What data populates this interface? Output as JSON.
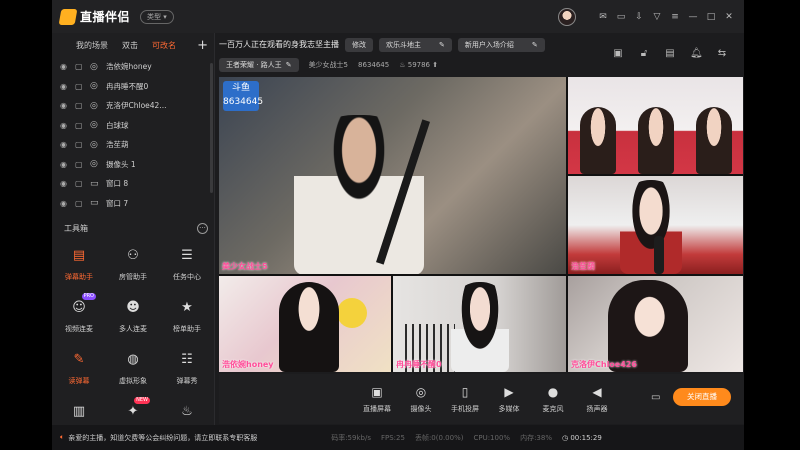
{
  "app": {
    "name": "直播伴侣",
    "type_label": "类型"
  },
  "scene_tabs": [
    "我的场景",
    "双击",
    "可改名"
  ],
  "sources": [
    {
      "name": "浩依婉honey",
      "kind": "camera-icon"
    },
    {
      "name": "冉冉睡不醒0",
      "kind": "camera-icon"
    },
    {
      "name": "克洛伊Chloe42...",
      "kind": "camera-icon"
    },
    {
      "name": "白球球",
      "kind": "camera-icon"
    },
    {
      "name": "浩苼葫",
      "kind": "camera-icon"
    },
    {
      "name": "摄像头 1",
      "kind": "camera-icon"
    },
    {
      "name": "窗口 8",
      "kind": "window-icon"
    },
    {
      "name": "窗口 7",
      "kind": "window-icon"
    }
  ],
  "toolbox": {
    "title": "工具箱",
    "items": [
      {
        "label": "弹幕助手",
        "icon": "danmaku-icon",
        "active": true
      },
      {
        "label": "房管助手",
        "icon": "user-manage-icon"
      },
      {
        "label": "任务中心",
        "icon": "task-icon"
      },
      {
        "label": "视频连麦",
        "icon": "video-call-icon",
        "badge": "PRO"
      },
      {
        "label": "多人连麦",
        "icon": "multi-call-icon"
      },
      {
        "label": "榜单助手",
        "icon": "rank-icon"
      },
      {
        "label": "读弹幕",
        "icon": "read-danmaku-icon",
        "active": true
      },
      {
        "label": "虚拟形象",
        "icon": "avatar-icon"
      },
      {
        "label": "弹幕秀",
        "icon": "danmaku-show-icon"
      },
      {
        "label": "",
        "icon": "book-icon"
      },
      {
        "label": "",
        "icon": "game-icon",
        "badge": "NEW"
      },
      {
        "label": "",
        "icon": "fire-icon"
      }
    ]
  },
  "stream": {
    "title": "一百万人正在观看的身我志坚主播",
    "edit_label": "修改",
    "category": "欢乐斗地主",
    "greeting": "新用户入场介绍",
    "game_tag": "王者荣耀 · 路人王",
    "streamer": "美少女战士5",
    "room_id": "8634645",
    "hot": "59786"
  },
  "tiles": [
    {
      "label": "美少女战士5"
    },
    {
      "label": ""
    },
    {
      "label": "浩苼葫"
    },
    {
      "label": "浩依婉honey"
    },
    {
      "label": "冉冉睡不醒0"
    },
    {
      "label": "克洛伊Chloe426"
    }
  ],
  "bottom_tools": [
    {
      "label": "直播屏幕",
      "icon": "screen-icon"
    },
    {
      "label": "摄像头",
      "icon": "camera-icon"
    },
    {
      "label": "手机投屏",
      "icon": "phone-cast-icon"
    },
    {
      "label": "多媒体",
      "icon": "media-icon"
    },
    {
      "label": "麦克风",
      "icon": "mic-icon"
    },
    {
      "label": "扬声器",
      "icon": "speaker-icon"
    }
  ],
  "close_live_label": "关闭直播",
  "status": {
    "notice": "亲爱的主播，知道欠费等公会纠纷问题，请立即联系专职客服",
    "bitrate": "码率:59kb/s",
    "fps": "FPS:25",
    "dropped": "丢帧:0(0.00%)",
    "cpu": "CPU:100%",
    "mem": "内存:38%",
    "clock": "00:15:29"
  },
  "colors": {
    "accent": "#ff6a33",
    "live_button": "#ff8a1c",
    "tile_label": "#ff4f9a"
  }
}
